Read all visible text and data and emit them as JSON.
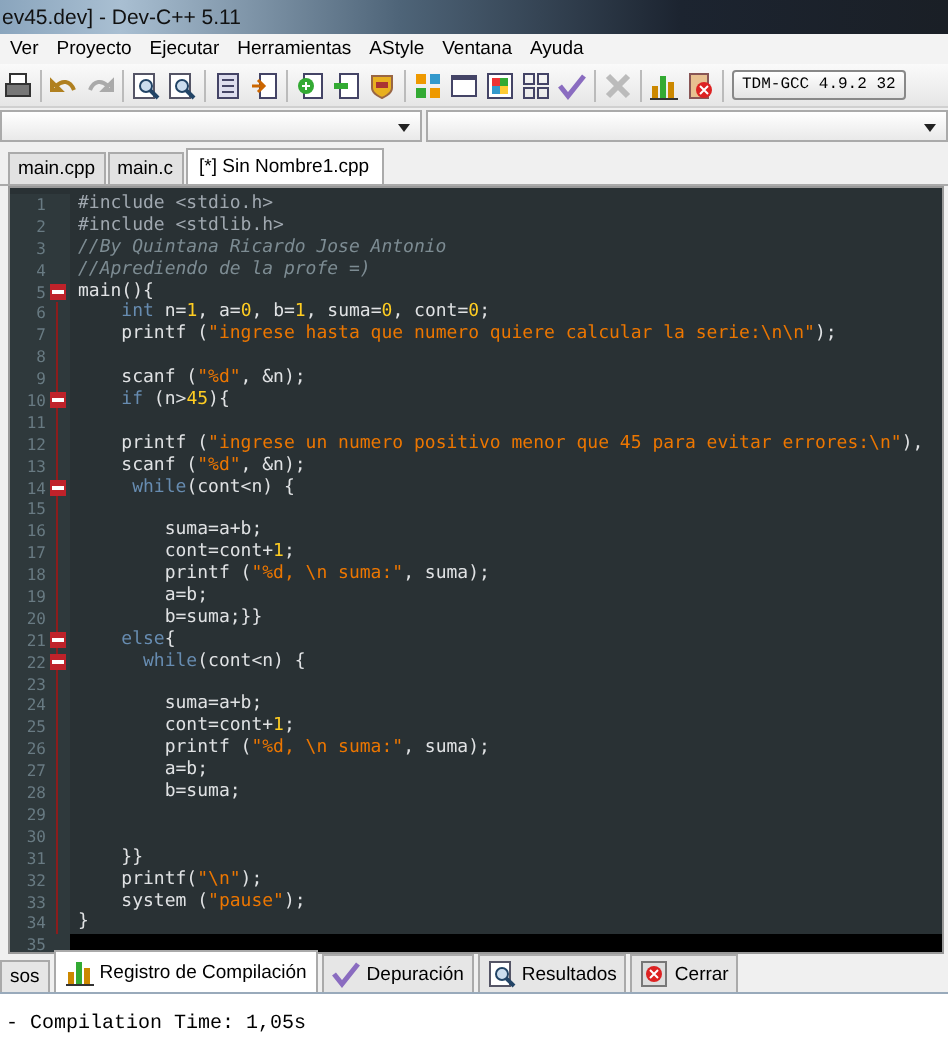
{
  "window": {
    "title": "ev45.dev] - Dev-C++ 5.11"
  },
  "menu": [
    "Ver",
    "Proyecto",
    "Ejecutar",
    "Herramientas",
    "AStyle",
    "Ventana",
    "Ayuda"
  ],
  "toolbar": {
    "compiler": "TDM-GCC 4.9.2 32"
  },
  "tabs": [
    {
      "label": "main.cpp",
      "selected": false
    },
    {
      "label": "main.c",
      "selected": false
    },
    {
      "label": "[*] Sin Nombre1.cpp",
      "selected": true
    }
  ],
  "editor": {
    "lines": [
      {
        "number": "1",
        "fold": false,
        "tokens": [
          {
            "kind": "pre",
            "text": "#include <stdio.h>"
          }
        ]
      },
      {
        "number": "2",
        "fold": false,
        "tokens": [
          {
            "kind": "pre",
            "text": "#include <stdlib.h>"
          }
        ]
      },
      {
        "number": "3",
        "fold": false,
        "tokens": [
          {
            "kind": "comment",
            "text": "//By Quintana Ricardo Jose Antonio"
          }
        ]
      },
      {
        "number": "4",
        "fold": false,
        "tokens": [
          {
            "kind": "comment",
            "text": "//Aprediendo de la profe =)"
          }
        ]
      },
      {
        "number": "5",
        "fold": true,
        "tokens": [
          {
            "kind": "plain",
            "text": "main(){"
          }
        ]
      },
      {
        "number": "6",
        "fold": false,
        "tokens": [
          {
            "kind": "keyword",
            "text": "    int"
          },
          {
            "kind": "plain",
            "text": " n="
          },
          {
            "kind": "number",
            "text": "1"
          },
          {
            "kind": "plain",
            "text": ", a="
          },
          {
            "kind": "number",
            "text": "0"
          },
          {
            "kind": "plain",
            "text": ", b="
          },
          {
            "kind": "number",
            "text": "1"
          },
          {
            "kind": "plain",
            "text": ", suma="
          },
          {
            "kind": "number",
            "text": "0"
          },
          {
            "kind": "plain",
            "text": ", cont="
          },
          {
            "kind": "number",
            "text": "0"
          },
          {
            "kind": "plain",
            "text": ";"
          }
        ]
      },
      {
        "number": "7",
        "fold": false,
        "tokens": [
          {
            "kind": "plain",
            "text": "    printf ("
          },
          {
            "kind": "string",
            "text": "\"ingrese hasta que numero quiere calcular la serie:\\n\\n\""
          },
          {
            "kind": "plain",
            "text": ");"
          }
        ]
      },
      {
        "number": "8",
        "fold": false
      },
      {
        "number": "9",
        "fold": false,
        "tokens": [
          {
            "kind": "plain",
            "text": "    scanf ("
          },
          {
            "kind": "string",
            "text": "\"%d\""
          },
          {
            "kind": "plain",
            "text": ", &n);"
          }
        ]
      },
      {
        "number": "10",
        "fold": true,
        "tokens": [
          {
            "kind": "keyword",
            "text": "    if"
          },
          {
            "kind": "plain",
            "text": " (n>"
          },
          {
            "kind": "number",
            "text": "45"
          },
          {
            "kind": "plain",
            "text": "){"
          }
        ]
      },
      {
        "number": "11",
        "fold": false
      },
      {
        "number": "12",
        "fold": false,
        "tokens": [
          {
            "kind": "plain",
            "text": "    printf ("
          },
          {
            "kind": "string",
            "text": "\"ingrese un numero positivo menor que 45 para evitar errores:\\n\""
          },
          {
            "kind": "plain",
            "text": "),"
          }
        ]
      },
      {
        "number": "13",
        "fold": false,
        "tokens": [
          {
            "kind": "plain",
            "text": "    scanf ("
          },
          {
            "kind": "string",
            "text": "\"%d\""
          },
          {
            "kind": "plain",
            "text": ", &n);"
          }
        ]
      },
      {
        "number": "14",
        "fold": true,
        "tokens": [
          {
            "kind": "keyword",
            "text": "     while"
          },
          {
            "kind": "plain",
            "text": "(cont<n) {"
          }
        ]
      },
      {
        "number": "15",
        "fold": false
      },
      {
        "number": "16",
        "fold": false,
        "tokens": [
          {
            "kind": "plain",
            "text": "        suma=a+b;"
          }
        ]
      },
      {
        "number": "17",
        "fold": false,
        "tokens": [
          {
            "kind": "plain",
            "text": "        cont=cont+"
          },
          {
            "kind": "number",
            "text": "1"
          },
          {
            "kind": "plain",
            "text": ";"
          }
        ]
      },
      {
        "number": "18",
        "fold": false,
        "tokens": [
          {
            "kind": "plain",
            "text": "        printf ("
          },
          {
            "kind": "string",
            "text": "\"%d, \\n suma:\""
          },
          {
            "kind": "plain",
            "text": ", suma);"
          }
        ]
      },
      {
        "number": "19",
        "fold": false,
        "tokens": [
          {
            "kind": "plain",
            "text": "        a=b;"
          }
        ]
      },
      {
        "number": "20",
        "fold": false,
        "tokens": [
          {
            "kind": "plain",
            "text": "        b=suma;}}"
          }
        ]
      },
      {
        "number": "21",
        "fold": true,
        "tokens": [
          {
            "kind": "keyword",
            "text": "    else"
          },
          {
            "kind": "plain",
            "text": "{"
          }
        ]
      },
      {
        "number": "22",
        "fold": true,
        "tokens": [
          {
            "kind": "keyword",
            "text": "      while"
          },
          {
            "kind": "plain",
            "text": "(cont<n) {"
          }
        ]
      },
      {
        "number": "23",
        "fold": false
      },
      {
        "number": "24",
        "fold": false,
        "tokens": [
          {
            "kind": "plain",
            "text": "        suma=a+b;"
          }
        ]
      },
      {
        "number": "25",
        "fold": false,
        "tokens": [
          {
            "kind": "plain",
            "text": "        cont=cont+"
          },
          {
            "kind": "number",
            "text": "1"
          },
          {
            "kind": "plain",
            "text": ";"
          }
        ]
      },
      {
        "number": "26",
        "fold": false,
        "tokens": [
          {
            "kind": "plain",
            "text": "        printf ("
          },
          {
            "kind": "string",
            "text": "\"%d, \\n suma:\""
          },
          {
            "kind": "plain",
            "text": ", suma);"
          }
        ]
      },
      {
        "number": "27",
        "fold": false,
        "tokens": [
          {
            "kind": "plain",
            "text": "        a=b;"
          }
        ]
      },
      {
        "number": "28",
        "fold": false,
        "tokens": [
          {
            "kind": "plain",
            "text": "        b=suma;"
          }
        ]
      },
      {
        "number": "29",
        "fold": false
      },
      {
        "number": "30",
        "fold": false
      },
      {
        "number": "31",
        "fold": false,
        "tokens": [
          {
            "kind": "plain",
            "text": "    }}"
          }
        ]
      },
      {
        "number": "32",
        "fold": false,
        "tokens": [
          {
            "kind": "plain",
            "text": "    printf("
          },
          {
            "kind": "string",
            "text": "\"\\n\""
          },
          {
            "kind": "plain",
            "text": ");"
          }
        ]
      },
      {
        "number": "33",
        "fold": false,
        "tokens": [
          {
            "kind": "plain",
            "text": "    system ("
          },
          {
            "kind": "string",
            "text": "\"pause\""
          },
          {
            "kind": "plain",
            "text": ");"
          }
        ]
      },
      {
        "number": "34",
        "fold": false,
        "tokens": [
          {
            "kind": "plain",
            "text": "}"
          }
        ]
      },
      {
        "number": "35",
        "fold": false,
        "highlighted": true
      }
    ]
  },
  "bottom_tabs": [
    {
      "label": "sos",
      "selected": false
    },
    {
      "label": "Registro de Compilación",
      "selected": true
    },
    {
      "label": "Depuración",
      "selected": false
    },
    {
      "label": "Resultados",
      "selected": false
    },
    {
      "label": "Cerrar",
      "selected": false
    }
  ],
  "output": {
    "text": "- Compilation Time: 1,05s"
  }
}
